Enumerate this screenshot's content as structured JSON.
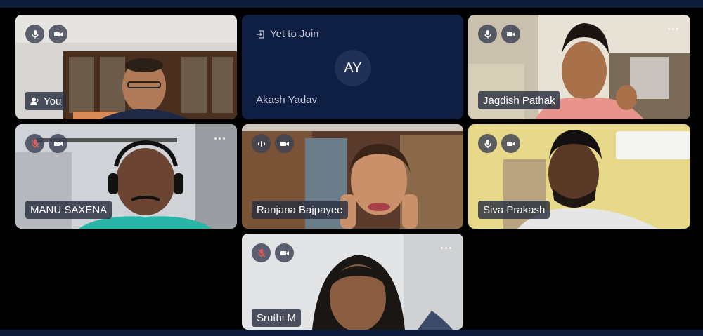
{
  "app": {
    "accent": "#0f1f43",
    "background": "#000000"
  },
  "participants": [
    {
      "name": "You",
      "mic": "on",
      "camera": "on",
      "name_icon": "user-audio-icon"
    },
    {
      "name": "Akash Yadav",
      "status": "Yet to Join",
      "initials": "AY"
    },
    {
      "name": "Jagdish Pathak",
      "mic": "on",
      "camera": "on"
    },
    {
      "name": "MANU SAXENA",
      "mic": "muted",
      "camera": "on"
    },
    {
      "name": "Ranjana Bajpayee",
      "mic": "speaking",
      "camera": "on"
    },
    {
      "name": "Siva Prakash",
      "mic": "on",
      "camera": "on"
    },
    {
      "name": "Sruthi M",
      "mic": "muted",
      "camera": "on"
    }
  ]
}
